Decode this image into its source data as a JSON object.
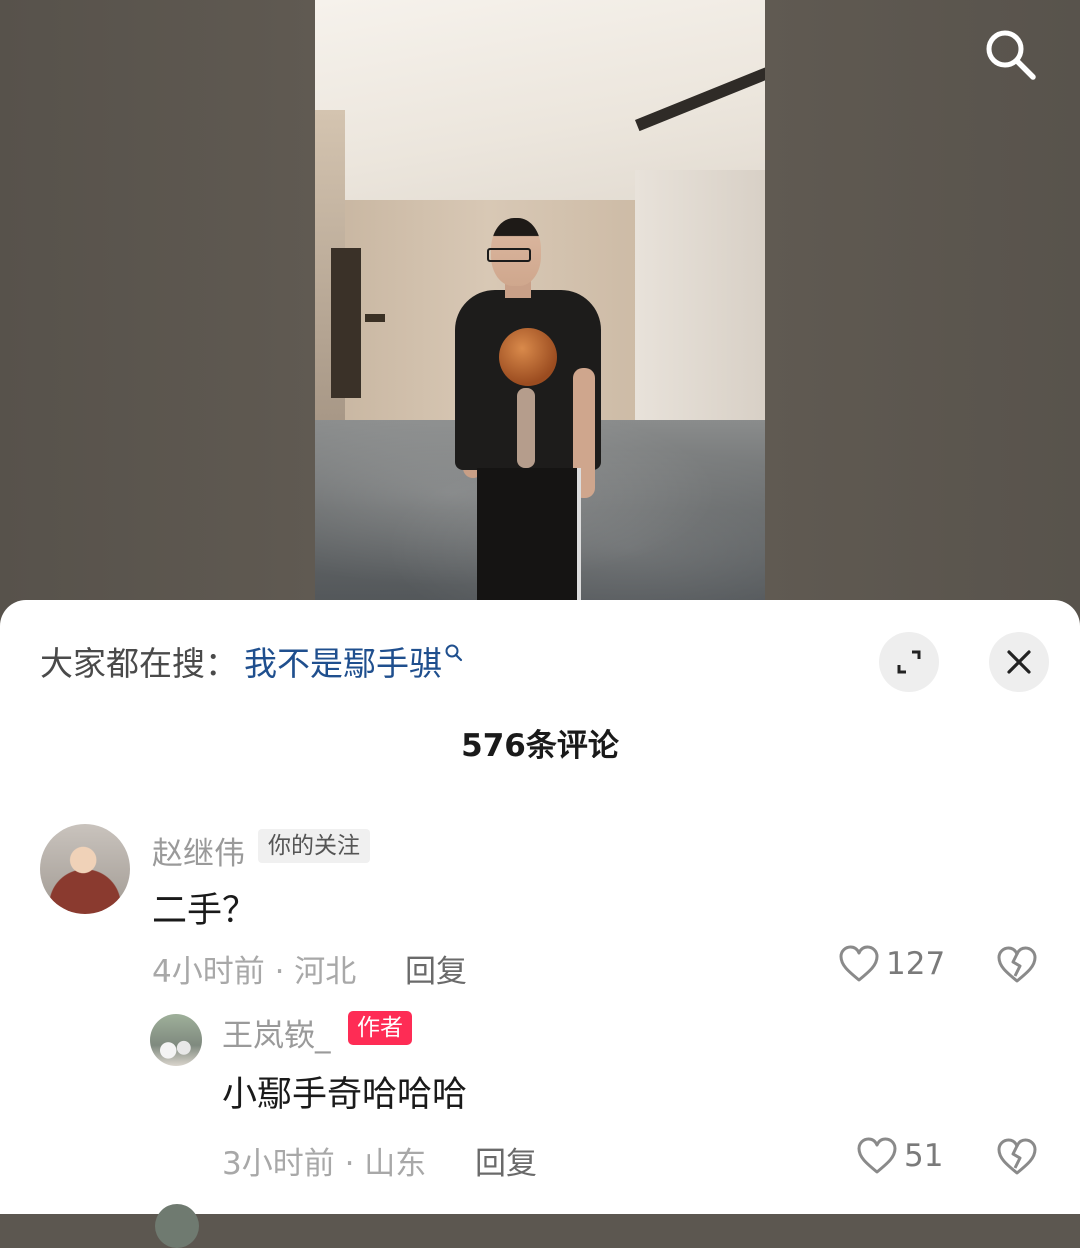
{
  "hot_search": {
    "label": "大家都在搜：",
    "term": "我不是鄢手骐"
  },
  "comments_header": {
    "count_label": "576条评论"
  },
  "comments": [
    {
      "username": "赵继伟",
      "tag": "你的关注",
      "text": "二手？",
      "time_location": "4小时前 · 河北",
      "reply_label": "回复",
      "likes": "127"
    },
    {
      "username": "王岚嵚_",
      "tag": "作者",
      "text": "小鄢手奇哈哈哈",
      "time_location": "3小时前 · 山东",
      "reply_label": "回复",
      "likes": "51"
    }
  ],
  "icons": {
    "search": "search-icon",
    "expand": "expand-icon",
    "close": "close-icon",
    "like": "heart-icon",
    "dislike": "broken-heart-icon"
  },
  "colors": {
    "link_blue": "#1f4f8e",
    "author_tag": "#fe2c55",
    "sheet_bg": "#ffffff"
  }
}
